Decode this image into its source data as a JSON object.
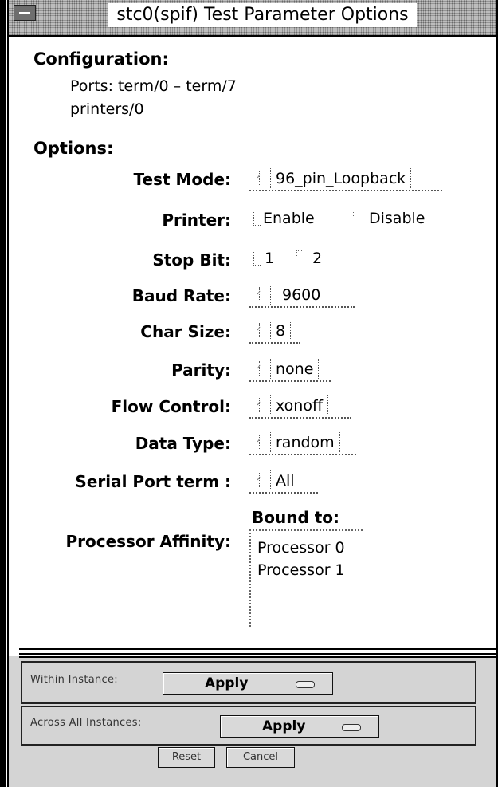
{
  "window": {
    "title": "stc0(spif) Test Parameter Options"
  },
  "configuration": {
    "heading": "Configuration:",
    "ports": "Ports: term/0 – term/7",
    "printers": "printers/0"
  },
  "options": {
    "heading": "Options:",
    "test_mode": {
      "label": "Test Mode:",
      "value": "96_pin_Loopback"
    },
    "printer": {
      "label": "Printer:",
      "choices": [
        "Enable",
        "Disable"
      ],
      "selected": "Enable"
    },
    "stop_bit": {
      "label": "Stop Bit:",
      "choices": [
        "1",
        "2"
      ],
      "selected": "1"
    },
    "baud_rate": {
      "label": "Baud Rate:",
      "value": "9600"
    },
    "char_size": {
      "label": "Char Size:",
      "value": "8"
    },
    "parity": {
      "label": "Parity:",
      "value": "none"
    },
    "flow_control": {
      "label": "Flow Control:",
      "value": "xonoff"
    },
    "data_type": {
      "label": "Data Type:",
      "value": "random"
    },
    "serial_port": {
      "label": "Serial Port term :",
      "value": "All"
    },
    "processor_affinity": {
      "label": "Processor Affinity:",
      "bound_to_label": "Bound to:",
      "items": [
        "Processor 0",
        "Processor 1"
      ]
    }
  },
  "footer": {
    "within_instance": {
      "label": "Within Instance:",
      "button": "Apply"
    },
    "across_instances": {
      "label": "Across All Instances:",
      "button": "Apply"
    },
    "reset": "Reset",
    "cancel": "Cancel"
  }
}
